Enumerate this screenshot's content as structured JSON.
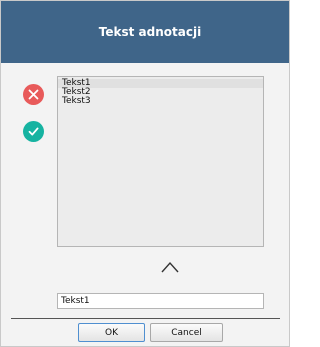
{
  "dialog": {
    "title": "Tekst adnotacji"
  },
  "icons": {
    "remove": {
      "name": "close-icon",
      "color": "#e85a5a"
    },
    "accept": {
      "name": "check-icon",
      "color": "#16b3a1"
    },
    "up": {
      "name": "chevron-up-icon"
    }
  },
  "list": {
    "items": [
      "Tekst1",
      "Tekst2",
      "Tekst3"
    ],
    "selected_index": 0
  },
  "input": {
    "value": "Tekst1"
  },
  "buttons": {
    "ok_label": "OK",
    "cancel_label": "Cancel"
  },
  "colors": {
    "title_bar": "#3f6589",
    "title_text": "#ffffff"
  }
}
